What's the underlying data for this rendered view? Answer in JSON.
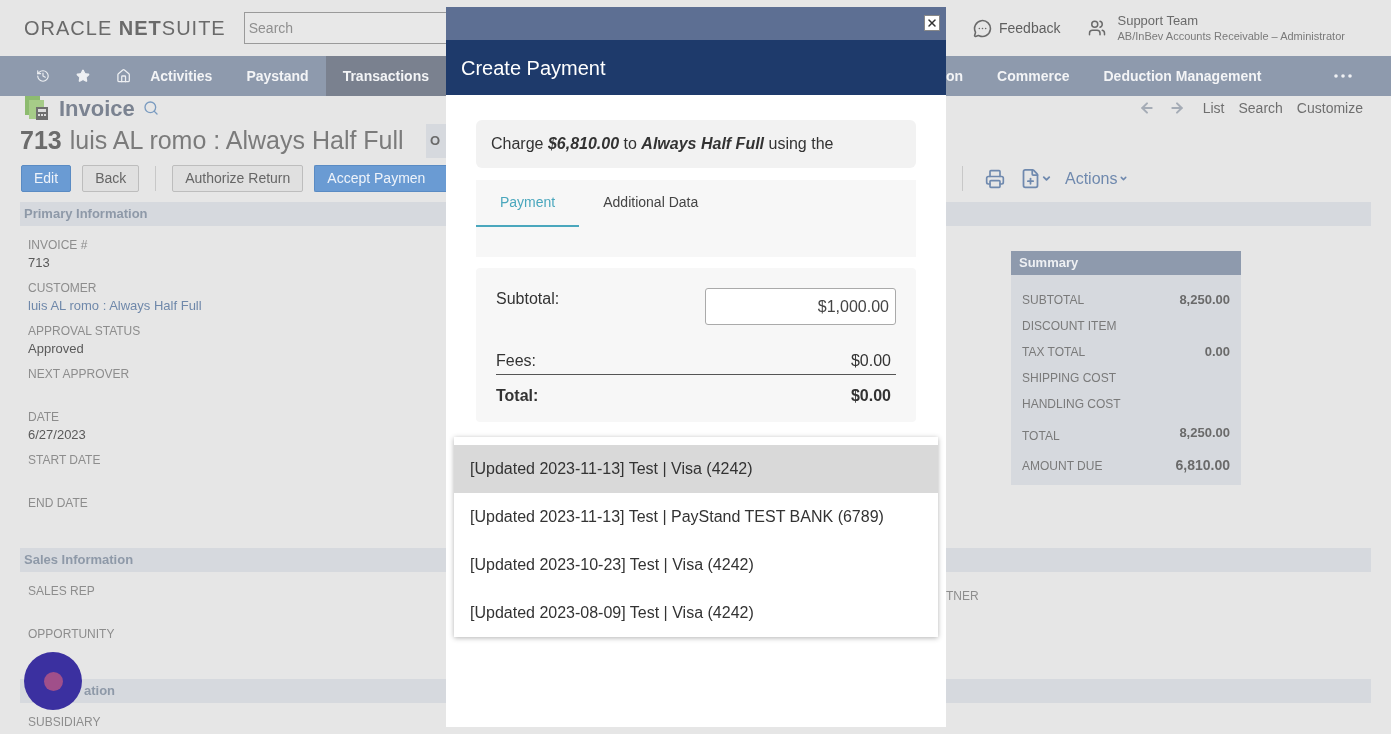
{
  "header": {
    "logo": "ORACLE **NET**SUITE",
    "search": {
      "placeholder": "Search"
    },
    "feedback": "Feedback",
    "user": {
      "name": "Support Team",
      "role": "AB/InBev Accounts Receivable – Administrator"
    }
  },
  "nav": {
    "left": [
      {
        "label": "Activities",
        "selected": false
      },
      {
        "label": "Paystand",
        "selected": false
      },
      {
        "label": "Transactions",
        "selected": true
      }
    ],
    "right": [
      {
        "label": "on",
        "selected": false
      },
      {
        "label": "Commerce",
        "selected": false
      },
      {
        "label": "Deduction Management",
        "selected": false
      }
    ]
  },
  "record": {
    "type": "Invoice",
    "number": "713",
    "name": "luis AL romo : Always Half Full",
    "badge": "O"
  },
  "buttons": [
    {
      "label": "Edit",
      "kind": "primary"
    },
    {
      "label": "Back",
      "kind": "secondary"
    },
    {
      "label": "Authorize Return",
      "kind": "secondary"
    },
    {
      "label": "Accept Paymen",
      "kind": "primary"
    }
  ],
  "record_links": [
    "List",
    "Search",
    "Customize"
  ],
  "actions": "Actions",
  "sections": [
    {
      "title": "Primary Information",
      "fields": [
        {
          "label": "INVOICE #",
          "value": "713",
          "kind": "text"
        },
        {
          "label": "CUSTOMER",
          "value": "luis AL romo : Always Half Full",
          "kind": "link"
        },
        {
          "label": "APPROVAL STATUS",
          "value": "Approved",
          "kind": "text"
        },
        {
          "label": "NEXT APPROVER"
        },
        {
          "label": "DATE",
          "value": "6/27/2023",
          "kind": "text"
        },
        {
          "label": "START DATE"
        },
        {
          "label": "END DATE"
        }
      ]
    },
    {
      "title": "Sales Information",
      "fields": [
        {
          "label": "SALES REP"
        },
        {
          "label": "OPPORTUNITY"
        }
      ],
      "right_fields": [
        {
          "label": "TNER"
        }
      ]
    },
    {
      "title": "ation",
      "fields": [
        {
          "label": "SUBSIDIARY"
        }
      ]
    }
  ],
  "summary": {
    "title": "Summary",
    "rows": [
      {
        "label": "SUBTOTAL",
        "value": "8,250.00",
        "kind": "normal"
      },
      {
        "label": "DISCOUNT ITEM",
        "kind": "normal"
      },
      {
        "label": "TAX TOTAL",
        "value": "0.00",
        "kind": "normal"
      },
      {
        "label": "SHIPPING COST",
        "kind": "normal"
      },
      {
        "label": "HANDLING COST",
        "kind": "normal"
      },
      {
        "label": "TOTAL",
        "value": "8,250.00",
        "kind": "total"
      },
      {
        "label": "AMOUNT DUE",
        "value": "6,810.00",
        "kind": "due"
      }
    ]
  },
  "modal": {
    "title": "Create Payment",
    "charge": "Charge **$6,810.00** to **Always Half Full** using the",
    "tabs": [
      {
        "label": "Payment",
        "selected": true
      },
      {
        "label": "Additional Data",
        "selected": false
      }
    ],
    "subtotal": {
      "label": "Subtotal:",
      "value": "$1,000.00"
    },
    "fees": {
      "label": "Fees:",
      "value": "$0.00"
    },
    "total": {
      "label": "Total:",
      "value": "$0.00"
    },
    "options": [
      {
        "label": "[Updated 2023-11-13] Test | Visa (4242)",
        "selected": true
      },
      {
        "label": "[Updated 2023-11-13] Test | PayStand TEST BANK (6789)",
        "selected": false
      },
      {
        "label": "[Updated 2023-10-23] Test | Visa (4242)",
        "selected": false
      },
      {
        "label": "[Updated 2023-08-09] Test | Visa (4242)",
        "selected": false
      }
    ]
  }
}
